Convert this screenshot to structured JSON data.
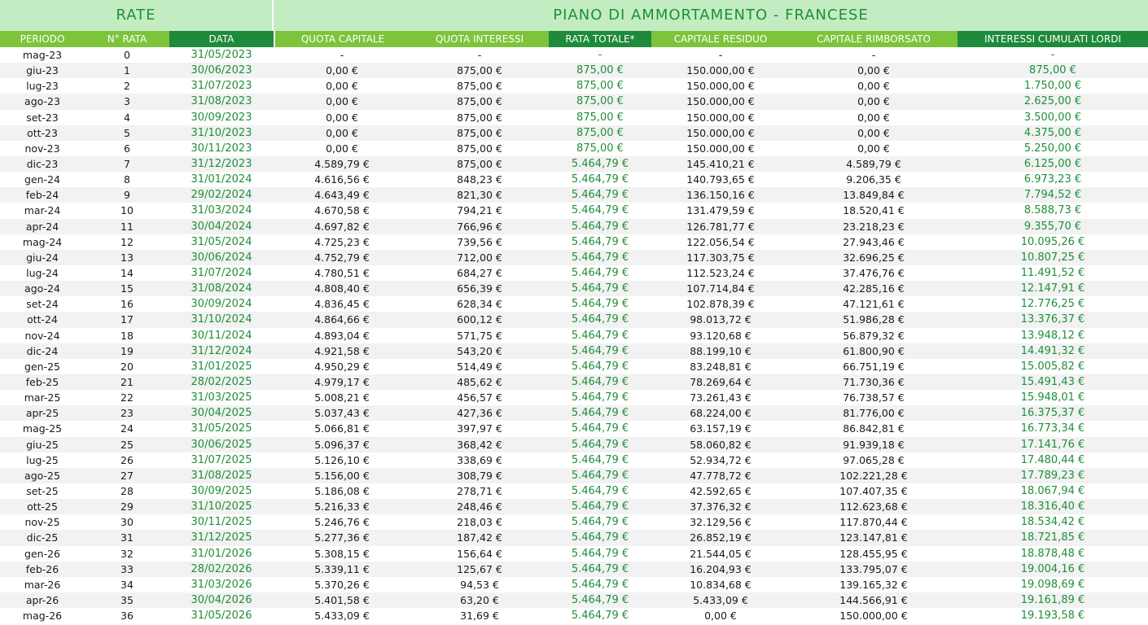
{
  "title_left": "RATE",
  "title_right": "PIANO DI AMMORTAMENTO - FRANCESE",
  "headers": [
    "PERIODO",
    "N° RATA",
    "DATA",
    "QUOTA CAPITALE",
    "QUOTA INTERESSI",
    "RATA TOTALE*",
    "CAPITALE RESIDUO",
    "CAPITALE RIMBORSATO",
    "INTERESSI CUMULATI LORDI"
  ],
  "colors": {
    "title_bg": "#c3ecc3",
    "header_light": "#7dc43b",
    "header_dark": "#1e8a3c",
    "accent_text": "#1e8f3a",
    "alt_row": "#f2f2f2"
  },
  "rows": [
    [
      "mag-23",
      "0",
      "31/05/2023",
      "-",
      "-",
      "-",
      "-",
      "-",
      "-"
    ],
    [
      "giu-23",
      "1",
      "30/06/2023",
      "0,00 €",
      "875,00 €",
      "875,00 €",
      "150.000,00 €",
      "0,00 €",
      "875,00 €"
    ],
    [
      "lug-23",
      "2",
      "31/07/2023",
      "0,00 €",
      "875,00 €",
      "875,00 €",
      "150.000,00 €",
      "0,00 €",
      "1.750,00 €"
    ],
    [
      "ago-23",
      "3",
      "31/08/2023",
      "0,00 €",
      "875,00 €",
      "875,00 €",
      "150.000,00 €",
      "0,00 €",
      "2.625,00 €"
    ],
    [
      "set-23",
      "4",
      "30/09/2023",
      "0,00 €",
      "875,00 €",
      "875,00 €",
      "150.000,00 €",
      "0,00 €",
      "3.500,00 €"
    ],
    [
      "ott-23",
      "5",
      "31/10/2023",
      "0,00 €",
      "875,00 €",
      "875,00 €",
      "150.000,00 €",
      "0,00 €",
      "4.375,00 €"
    ],
    [
      "nov-23",
      "6",
      "30/11/2023",
      "0,00 €",
      "875,00 €",
      "875,00 €",
      "150.000,00 €",
      "0,00 €",
      "5.250,00 €"
    ],
    [
      "dic-23",
      "7",
      "31/12/2023",
      "4.589,79 €",
      "875,00 €",
      "5.464,79 €",
      "145.410,21 €",
      "4.589,79 €",
      "6.125,00 €"
    ],
    [
      "gen-24",
      "8",
      "31/01/2024",
      "4.616,56 €",
      "848,23 €",
      "5.464,79 €",
      "140.793,65 €",
      "9.206,35 €",
      "6.973,23 €"
    ],
    [
      "feb-24",
      "9",
      "29/02/2024",
      "4.643,49 €",
      "821,30 €",
      "5.464,79 €",
      "136.150,16 €",
      "13.849,84 €",
      "7.794,52 €"
    ],
    [
      "mar-24",
      "10",
      "31/03/2024",
      "4.670,58 €",
      "794,21 €",
      "5.464,79 €",
      "131.479,59 €",
      "18.520,41 €",
      "8.588,73 €"
    ],
    [
      "apr-24",
      "11",
      "30/04/2024",
      "4.697,82 €",
      "766,96 €",
      "5.464,79 €",
      "126.781,77 €",
      "23.218,23 €",
      "9.355,70 €"
    ],
    [
      "mag-24",
      "12",
      "31/05/2024",
      "4.725,23 €",
      "739,56 €",
      "5.464,79 €",
      "122.056,54 €",
      "27.943,46 €",
      "10.095,26 €"
    ],
    [
      "giu-24",
      "13",
      "30/06/2024",
      "4.752,79 €",
      "712,00 €",
      "5.464,79 €",
      "117.303,75 €",
      "32.696,25 €",
      "10.807,25 €"
    ],
    [
      "lug-24",
      "14",
      "31/07/2024",
      "4.780,51 €",
      "684,27 €",
      "5.464,79 €",
      "112.523,24 €",
      "37.476,76 €",
      "11.491,52 €"
    ],
    [
      "ago-24",
      "15",
      "31/08/2024",
      "4.808,40 €",
      "656,39 €",
      "5.464,79 €",
      "107.714,84 €",
      "42.285,16 €",
      "12.147,91 €"
    ],
    [
      "set-24",
      "16",
      "30/09/2024",
      "4.836,45 €",
      "628,34 €",
      "5.464,79 €",
      "102.878,39 €",
      "47.121,61 €",
      "12.776,25 €"
    ],
    [
      "ott-24",
      "17",
      "31/10/2024",
      "4.864,66 €",
      "600,12 €",
      "5.464,79 €",
      "98.013,72 €",
      "51.986,28 €",
      "13.376,37 €"
    ],
    [
      "nov-24",
      "18",
      "30/11/2024",
      "4.893,04 €",
      "571,75 €",
      "5.464,79 €",
      "93.120,68 €",
      "56.879,32 €",
      "13.948,12 €"
    ],
    [
      "dic-24",
      "19",
      "31/12/2024",
      "4.921,58 €",
      "543,20 €",
      "5.464,79 €",
      "88.199,10 €",
      "61.800,90 €",
      "14.491,32 €"
    ],
    [
      "gen-25",
      "20",
      "31/01/2025",
      "4.950,29 €",
      "514,49 €",
      "5.464,79 €",
      "83.248,81 €",
      "66.751,19 €",
      "15.005,82 €"
    ],
    [
      "feb-25",
      "21",
      "28/02/2025",
      "4.979,17 €",
      "485,62 €",
      "5.464,79 €",
      "78.269,64 €",
      "71.730,36 €",
      "15.491,43 €"
    ],
    [
      "mar-25",
      "22",
      "31/03/2025",
      "5.008,21 €",
      "456,57 €",
      "5.464,79 €",
      "73.261,43 €",
      "76.738,57 €",
      "15.948,01 €"
    ],
    [
      "apr-25",
      "23",
      "30/04/2025",
      "5.037,43 €",
      "427,36 €",
      "5.464,79 €",
      "68.224,00 €",
      "81.776,00 €",
      "16.375,37 €"
    ],
    [
      "mag-25",
      "24",
      "31/05/2025",
      "5.066,81 €",
      "397,97 €",
      "5.464,79 €",
      "63.157,19 €",
      "86.842,81 €",
      "16.773,34 €"
    ],
    [
      "giu-25",
      "25",
      "30/06/2025",
      "5.096,37 €",
      "368,42 €",
      "5.464,79 €",
      "58.060,82 €",
      "91.939,18 €",
      "17.141,76 €"
    ],
    [
      "lug-25",
      "26",
      "31/07/2025",
      "5.126,10 €",
      "338,69 €",
      "5.464,79 €",
      "52.934,72 €",
      "97.065,28 €",
      "17.480,44 €"
    ],
    [
      "ago-25",
      "27",
      "31/08/2025",
      "5.156,00 €",
      "308,79 €",
      "5.464,79 €",
      "47.778,72 €",
      "102.221,28 €",
      "17.789,23 €"
    ],
    [
      "set-25",
      "28",
      "30/09/2025",
      "5.186,08 €",
      "278,71 €",
      "5.464,79 €",
      "42.592,65 €",
      "107.407,35 €",
      "18.067,94 €"
    ],
    [
      "ott-25",
      "29",
      "31/10/2025",
      "5.216,33 €",
      "248,46 €",
      "5.464,79 €",
      "37.376,32 €",
      "112.623,68 €",
      "18.316,40 €"
    ],
    [
      "nov-25",
      "30",
      "30/11/2025",
      "5.246,76 €",
      "218,03 €",
      "5.464,79 €",
      "32.129,56 €",
      "117.870,44 €",
      "18.534,42 €"
    ],
    [
      "dic-25",
      "31",
      "31/12/2025",
      "5.277,36 €",
      "187,42 €",
      "5.464,79 €",
      "26.852,19 €",
      "123.147,81 €",
      "18.721,85 €"
    ],
    [
      "gen-26",
      "32",
      "31/01/2026",
      "5.308,15 €",
      "156,64 €",
      "5.464,79 €",
      "21.544,05 €",
      "128.455,95 €",
      "18.878,48 €"
    ],
    [
      "feb-26",
      "33",
      "28/02/2026",
      "5.339,11 €",
      "125,67 €",
      "5.464,79 €",
      "16.204,93 €",
      "133.795,07 €",
      "19.004,16 €"
    ],
    [
      "mar-26",
      "34",
      "31/03/2026",
      "5.370,26 €",
      "94,53 €",
      "5.464,79 €",
      "10.834,68 €",
      "139.165,32 €",
      "19.098,69 €"
    ],
    [
      "apr-26",
      "35",
      "30/04/2026",
      "5.401,58 €",
      "63,20 €",
      "5.464,79 €",
      "5.433,09 €",
      "144.566,91 €",
      "19.161,89 €"
    ],
    [
      "mag-26",
      "36",
      "31/05/2026",
      "5.433,09 €",
      "31,69 €",
      "5.464,79 €",
      "0,00 €",
      "150.000,00 €",
      "19.193,58 €"
    ]
  ]
}
